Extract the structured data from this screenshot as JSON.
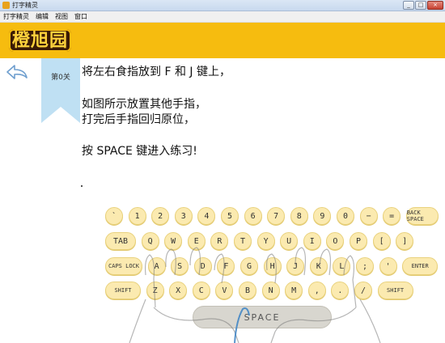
{
  "window": {
    "title": "打字精灵",
    "buttons": [
      "_",
      "□",
      "×"
    ]
  },
  "menu": [
    "打字精灵",
    "编辑",
    "视图",
    "窗口"
  ],
  "header": {
    "logo_text": "橙旭园",
    "color": "#f6bc0f"
  },
  "level": {
    "label": "第0关",
    "ribbon_color": "#bfe0f3"
  },
  "instructions": {
    "line1": "将左右食指放到 F 和 J 键上，",
    "line2": "如图所示放置其他手指，",
    "line3": "打完后手指回归原位，",
    "line4": "按 SPACE 键进入练习!"
  },
  "keyboard": {
    "key_color": "#fbeab0",
    "rows": [
      [
        "`",
        "1",
        "2",
        "3",
        "4",
        "5",
        "6",
        "7",
        "8",
        "9",
        "0",
        "−",
        "=",
        "BACK SPACE"
      ],
      [
        "TAB",
        "Q",
        "W",
        "E",
        "R",
        "T",
        "Y",
        "U",
        "I",
        "O",
        "P",
        "[",
        "]"
      ],
      [
        "CAPS LOCK",
        "A",
        "S",
        "D",
        "F",
        "G",
        "H",
        "J",
        "K",
        "L",
        ";",
        "'",
        "ENTER"
      ],
      [
        "SHIFT",
        "Z",
        "X",
        "C",
        "V",
        "B",
        "N",
        "M",
        ",",
        ".",
        "/",
        "SHIFT"
      ]
    ],
    "space_label": "SPACE"
  }
}
